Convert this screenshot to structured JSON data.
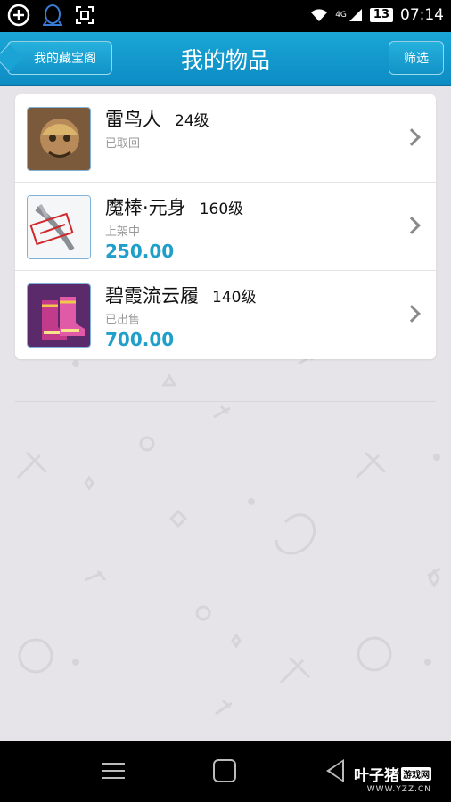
{
  "status_bar": {
    "network_type": "4G",
    "battery": "13",
    "time": "07:14",
    "icons": [
      "add-circle-icon",
      "qq-penguin-icon",
      "screenshot-icon",
      "wifi-icon",
      "signal-icon",
      "battery-icon"
    ]
  },
  "header": {
    "back_label": "我的藏宝阁",
    "title": "我的物品",
    "filter_label": "筛选",
    "color": "#1aa6d6"
  },
  "items": [
    {
      "name": "雷鸟人",
      "level": "24级",
      "status": "已取回",
      "price": "",
      "icon": "thunderbird-avatar-icon"
    },
    {
      "name": "魔棒·元身",
      "level": "160级",
      "status": "上架中",
      "price": "250.00",
      "icon": "magic-wand-icon"
    },
    {
      "name": "碧霞流云履",
      "level": "140级",
      "status": "已出售",
      "price": "700.00",
      "icon": "boots-icon"
    }
  ],
  "accent": "#1f9fc9",
  "watermark": {
    "main": "叶子猪",
    "badge": "游戏网",
    "url": "WWW.YZZ.CN"
  }
}
